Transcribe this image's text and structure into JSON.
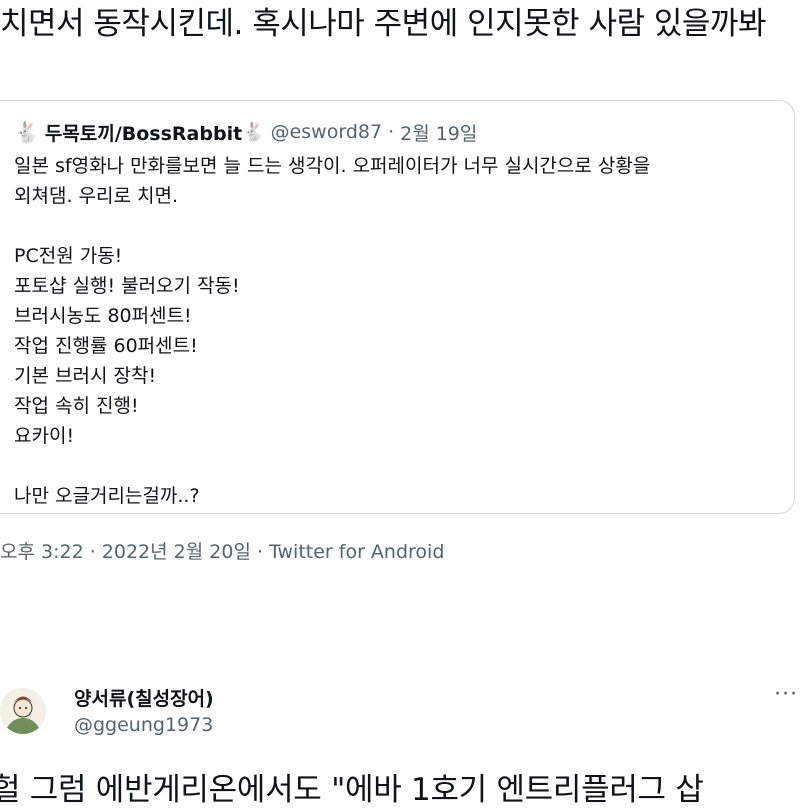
{
  "tweet": {
    "text": "치면서 동작시킨데. 혹시나마 주변에 인지못한 사람 있을까봐"
  },
  "quote": {
    "avatar_icon": "rabbit-icon",
    "author_name": "두목토끼/BossRabbit",
    "name_emoji": "🐇",
    "handle": "@esword87",
    "separator": "·",
    "date": "2월 19일",
    "lines": [
      "일본 sf영화나 만화를보면 늘 드는 생각이. 오퍼레이터가 너무 실시간으로 상황을",
      "외쳐댐. 우리로 치면.",
      "",
      "PC전원 가동!",
      "포토샵 실행! 불러오기 작동!",
      "브러시농도 80퍼센트!",
      "작업 진행률 60퍼센트!",
      "기본 브러시 장착!",
      "작업 속히 진행!",
      "요카이!",
      "",
      "나만 오글거리는걸까..?"
    ]
  },
  "meta": {
    "timestamp": "오후 3:22 · 2022년 2월 20일 · Twitter for Android"
  },
  "reply": {
    "avatar_icon": "user-avatar",
    "name": "양서류(칠성장어)",
    "handle": "@ggeung1973",
    "more_icon": "more-icon",
    "more_label": "···",
    "text": "헐 그럼 에반게리온에서도 \"에바 1호기 엔트리플러그 삽"
  }
}
